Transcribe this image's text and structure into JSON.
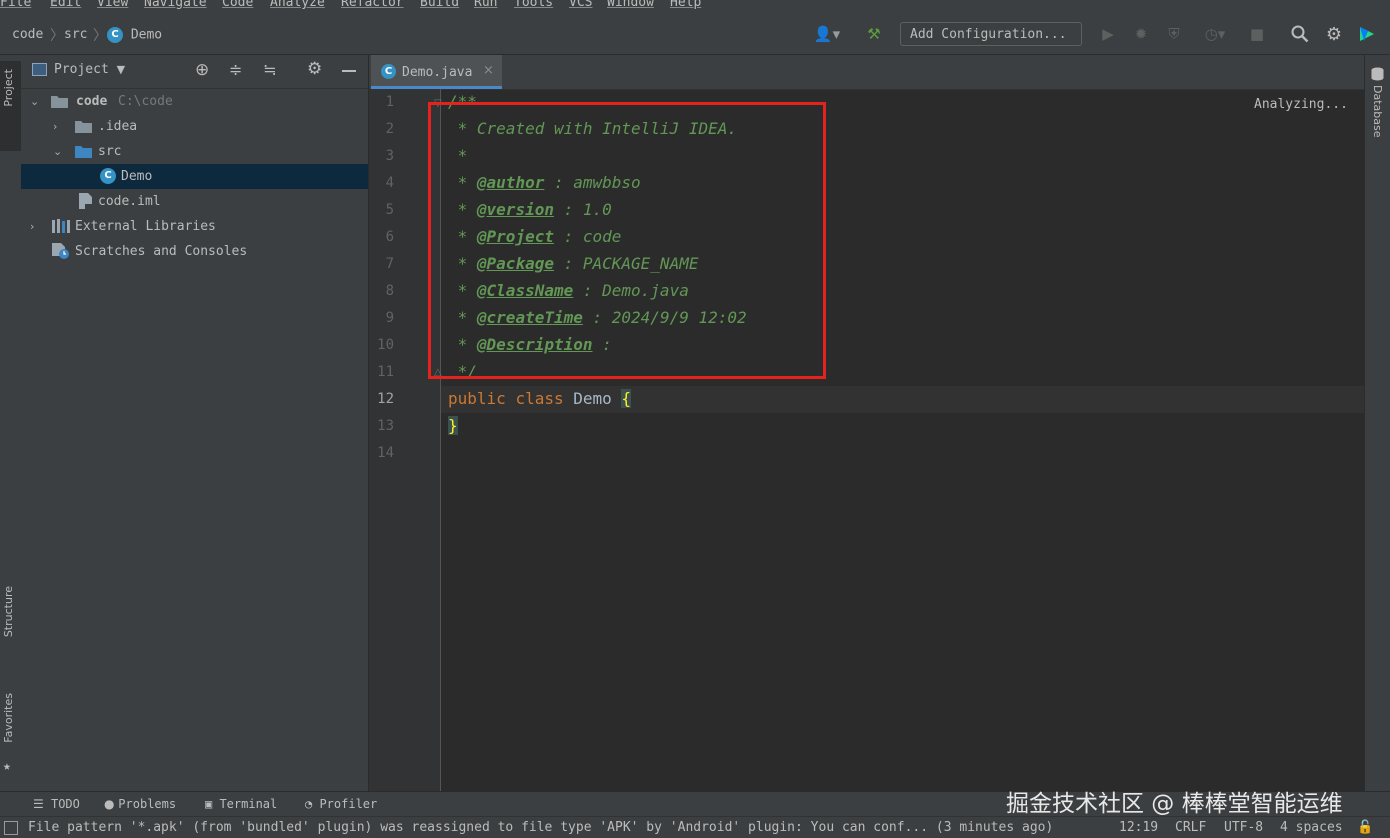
{
  "menu": [
    "File",
    "Edit",
    "View",
    "Navigate",
    "Code",
    "Analyze",
    "Refactor",
    "Build",
    "Run",
    "Tools",
    "VCS",
    "Window",
    "Help"
  ],
  "breadcrumb": [
    "code",
    "src",
    "Demo"
  ],
  "toolbar": {
    "add_configuration": "Add Configuration...",
    "icons": [
      "user-icon",
      "build-hammer-icon",
      "run-icon",
      "debug-icon",
      "coverage-icon",
      "profile-icon",
      "stop-icon",
      "search-icon",
      "settings-icon",
      "jetbrains-logo-icon"
    ]
  },
  "project_panel": {
    "title": "Project",
    "tree": [
      {
        "label": "code",
        "path": "C:\\code",
        "expanded": true
      },
      {
        "label": ".idea"
      },
      {
        "label": "src",
        "expanded": true
      },
      {
        "label": "Demo",
        "selected": true
      },
      {
        "label": "code.iml"
      },
      {
        "label": "External Libraries"
      },
      {
        "label": "Scratches and Consoles"
      }
    ]
  },
  "left_strip": {
    "project": "Project",
    "structure": "Structure",
    "favorites": "Favorites"
  },
  "right_strip": {
    "database": "Database"
  },
  "editor": {
    "tab": "Demo.java",
    "status": "Analyzing...",
    "line_numbers": [
      "1",
      "2",
      "3",
      "4",
      "5",
      "6",
      "7",
      "8",
      "9",
      "10",
      "11",
      "12",
      "13",
      "14"
    ],
    "current_line": "12",
    "comment": {
      "open": "/**",
      "line2": " * Created with IntelliJ IDEA.",
      "line3": " *",
      "star": " * ",
      "author_tag": "@author",
      "author_val": " : amwbbso",
      "version_tag": "@version",
      "version_val": " : 1.0",
      "project_tag": "@Project",
      "project_val": " : code",
      "package_tag": "@Package",
      "package_val": " : PACKAGE_NAME",
      "classname_tag": "@ClassName",
      "classname_val": " : Demo.java",
      "createtime_tag": "@createTime",
      "createtime_val": " : 2024/9/9 12:02",
      "description_tag": "@Description",
      "description_val": " :",
      "close": " */"
    },
    "code": {
      "public": "public",
      "class": "class",
      "name": "Demo",
      "open_brace": "{",
      "close_brace": "}"
    }
  },
  "bottom_tools": [
    "TODO",
    "Problems",
    "Terminal",
    "Profiler"
  ],
  "status_bar": {
    "message": "File pattern '*.apk' (from 'bundled' plugin) was reassigned to file type 'APK' by 'Android' plugin: You can conf... (3 minutes ago)",
    "position": "12:19",
    "line_sep": "CRLF",
    "encoding": "UTF-8",
    "indent": "4 spaces"
  },
  "watermark": "掘金技术社区 @ 棒棒堂智能运维"
}
